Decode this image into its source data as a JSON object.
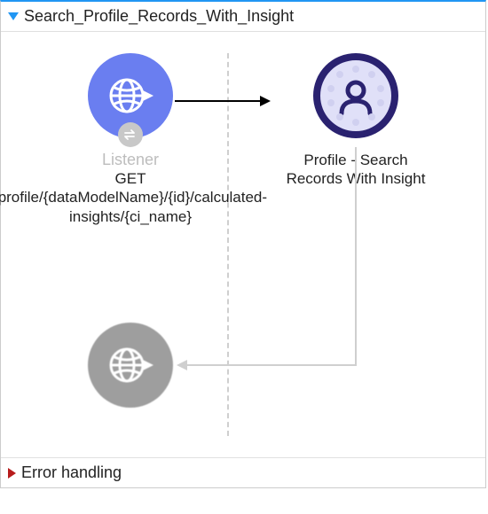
{
  "flow": {
    "title": "Search_Profile_Records_With_Insight",
    "nodes": {
      "listener": {
        "label": "Listener",
        "path": "GET /profile/{dataModelName}/{id}/calculated-insights/{ci_name}"
      },
      "profile": {
        "label": "Profile - Search Records With Insight"
      },
      "response": {
        "label": ""
      }
    }
  },
  "errorSection": {
    "title": "Error handling"
  },
  "icons": {
    "globe": "globe-arrow-icon",
    "swap": "swap-icon",
    "person": "person-icon"
  }
}
